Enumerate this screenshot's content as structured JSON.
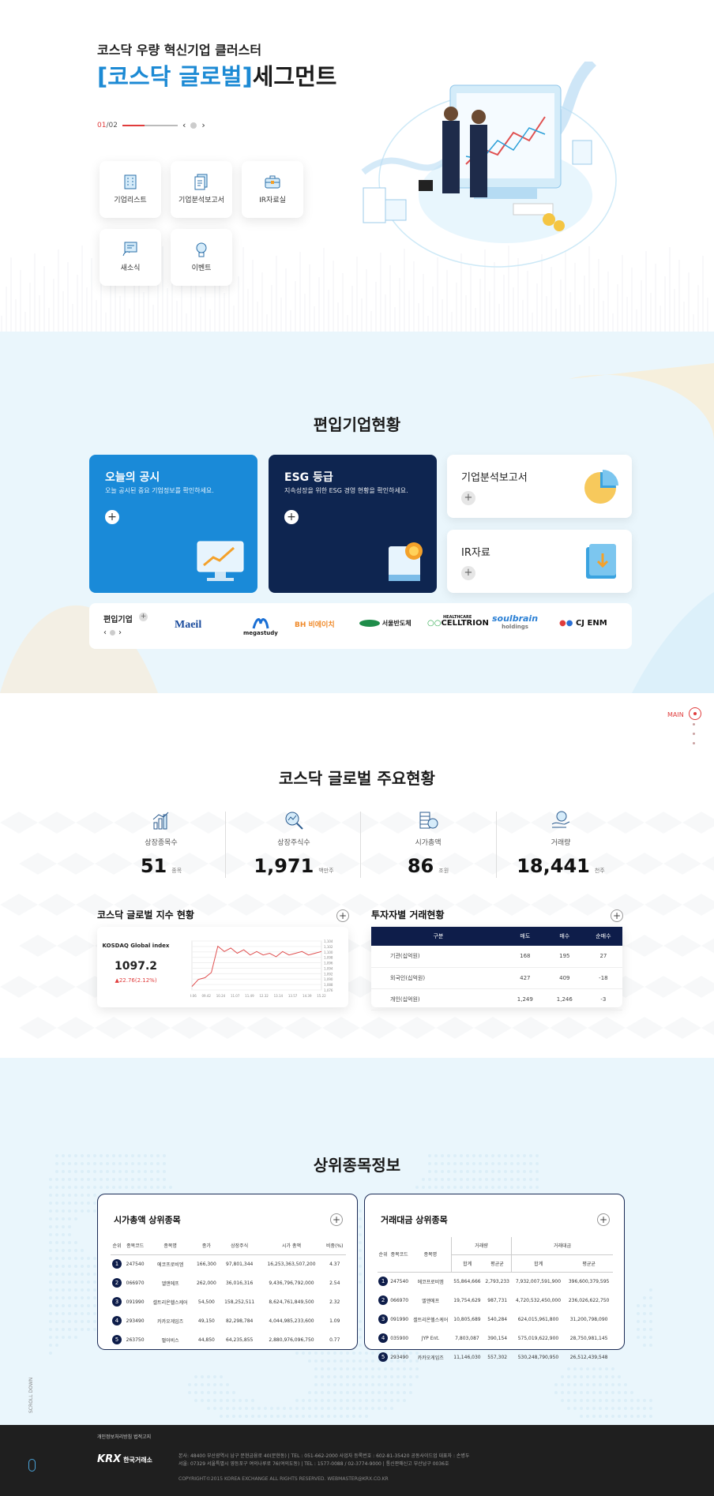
{
  "hero": {
    "subtitle": "코스닥 우량 혁신기업 클러스터",
    "title_bracket_open": "[",
    "title_highlight": "코스닥 글로벌",
    "title_bracket_close": "]",
    "title_rest": "세그먼트",
    "pager_current": "01",
    "pager_total": "/02",
    "prev": "‹",
    "next": "›"
  },
  "quick_menu": [
    {
      "label": "기업리스트",
      "icon": "building-icon"
    },
    {
      "label": "기업분석보고서",
      "icon": "report-icon"
    },
    {
      "label": "IR자료실",
      "icon": "briefcase-icon"
    },
    {
      "label": "새소식",
      "icon": "news-icon"
    },
    {
      "label": "이벤트",
      "icon": "lightbulb-icon"
    }
  ],
  "listed": {
    "title": "편입기업현황",
    "today": {
      "title": "오늘의 공시",
      "desc": "오늘 공시된 중요 기업정보를 확인하세요.",
      "color": "#1a8ad8"
    },
    "esg": {
      "title": "ESG 등급",
      "desc": "지속성장을 위한 ESG 경영 현황을 확인하세요.",
      "color": "#0e2550"
    },
    "analysis": {
      "title": "기업분석보고서"
    },
    "ir": {
      "title": "IR자료"
    },
    "plus": "+",
    "companies_label": "편입기업",
    "companies": [
      "Maeil",
      "megastudy",
      "BH 비에이치",
      "서울반도체",
      "CELLTRION",
      "soulbrain",
      "CJ ENM"
    ],
    "companies_sub": [
      "",
      "",
      "",
      "",
      "HEALTHCARE",
      "holdings",
      ""
    ]
  },
  "side_nav": {
    "label": "MAIN"
  },
  "status": {
    "title": "코스닥 글로벌 주요현황",
    "stats": [
      {
        "label": "상장종목수",
        "value": "51",
        "unit": "종목"
      },
      {
        "label": "상장주식수",
        "value": "1,971",
        "unit": "백만주"
      },
      {
        "label": "시가총액",
        "value": "86",
        "unit": "조원"
      },
      {
        "label": "거래량",
        "value": "18,441",
        "unit": "천주"
      }
    ],
    "index_title": "코스닥 글로벌 지수 현황",
    "index_name": "KOSDAQ Global index",
    "index_value": "1097.2",
    "index_change": "▲22.76(2.12%)",
    "investor_title": "투자자별 거래현황",
    "investor_headers": [
      "구분",
      "매도",
      "매수",
      "순매수"
    ],
    "investor_rows": [
      [
        "기관(십억원)",
        "168",
        "195",
        "27"
      ],
      [
        "외국인(십억원)",
        "427",
        "409",
        "-18"
      ],
      [
        "개인(십억원)",
        "1,249",
        "1,246",
        "-3"
      ]
    ]
  },
  "chart_data": {
    "type": "line",
    "title": "",
    "xlabel": "",
    "ylabel": "",
    "x": [
      "09.06",
      "09.42",
      "10.24",
      "11.07",
      "11.49",
      "12.32",
      "13.14",
      "13.57",
      "14.39",
      "15.22"
    ],
    "y_ticks": [
      "1,104",
      "1,102",
      "1,100",
      "1,098",
      "1,096",
      "1,094",
      "1,092",
      "1,090",
      "1,088",
      "1,076"
    ],
    "ylim": [
      1076,
      1104
    ],
    "series": [
      {
        "values": [
          1078,
          1082,
          1083,
          1086,
          1101,
          1098,
          1100,
          1097,
          1099,
          1096,
          1098,
          1096,
          1097,
          1095,
          1098,
          1096,
          1097,
          1098,
          1096,
          1097,
          1098
        ]
      }
    ],
    "color": "#e05050"
  },
  "top": {
    "title": "상위종목정보",
    "cap_title": "시가총액 상위종목",
    "cap_headers": [
      "순위",
      "종목코드",
      "종목명",
      "종가",
      "상장주식",
      "시가 총액",
      "비중(%)"
    ],
    "cap_rows": [
      [
        "1",
        "247540",
        "에코프로비엠",
        "166,300",
        "97,801,344",
        "16,253,363,507,200",
        "4.37"
      ],
      [
        "2",
        "066970",
        "엘앤에프",
        "262,000",
        "36,016,316",
        "9,436,796,792,000",
        "2.54"
      ],
      [
        "3",
        "091990",
        "셀트리온헬스케어",
        "54,500",
        "158,252,511",
        "8,624,761,849,500",
        "2.32"
      ],
      [
        "4",
        "293490",
        "카카오게임즈",
        "49,150",
        "82,298,784",
        "4,044,985,233,600",
        "1.09"
      ],
      [
        "5",
        "263750",
        "펄어비스",
        "44,850",
        "64,235,855",
        "2,880,976,096,750",
        "0.77"
      ]
    ],
    "vol_title": "거래대금 상위종목",
    "vol_headers": [
      "순위",
      "종목코드",
      "종목명",
      "거래량",
      "거래대금",
      "합계",
      "평균균",
      "합계",
      "평균균"
    ],
    "vol_rows": [
      [
        "1",
        "247540",
        "에코프로비엠",
        "55,864,666",
        "2,793,233",
        "7,932,007,591,900",
        "396,600,379,595"
      ],
      [
        "2",
        "066970",
        "엘앤에프",
        "19,754,629",
        "987,731",
        "4,720,532,450,000",
        "236,026,622,750"
      ],
      [
        "3",
        "091990",
        "셀트리온헬스케어",
        "10,805,689",
        "540,284",
        "624,015,961,800",
        "31,200,798,090"
      ],
      [
        "4",
        "035900",
        "JYP Ent.",
        "7,803,087",
        "390,154",
        "575,019,622,900",
        "28,750,981,145"
      ],
      [
        "5",
        "293490",
        "카카오게임즈",
        "11,146,030",
        "557,302",
        "530,248,790,950",
        "26,512,439,548"
      ]
    ]
  },
  "footer": {
    "links": "개인정보처리방침   법적고지",
    "brand": "KRX",
    "brand_sub": "한국거래소",
    "addr1": "본사: 48400 부산광역시 남구 문현금융로 40(문현동) | TEL : 051-662-2000 사업자 등록번호 : 602-81-35420 공동사이드업 대표자 : 손병두",
    "addr2": "서울: 07329 서울특별시 영등포구 여의나루로 76(여의도동) | TEL : 1577-0088 / 02-3774-9000 | 통신판매신고 부산남구 0036호",
    "copy": "COPYRIGHT©2015 KOREA EXCHANGE ALL RIGHTS RESERVED. WEBMASTER@KRX.CO.KR",
    "scroll": "SCROLL DOWN"
  }
}
